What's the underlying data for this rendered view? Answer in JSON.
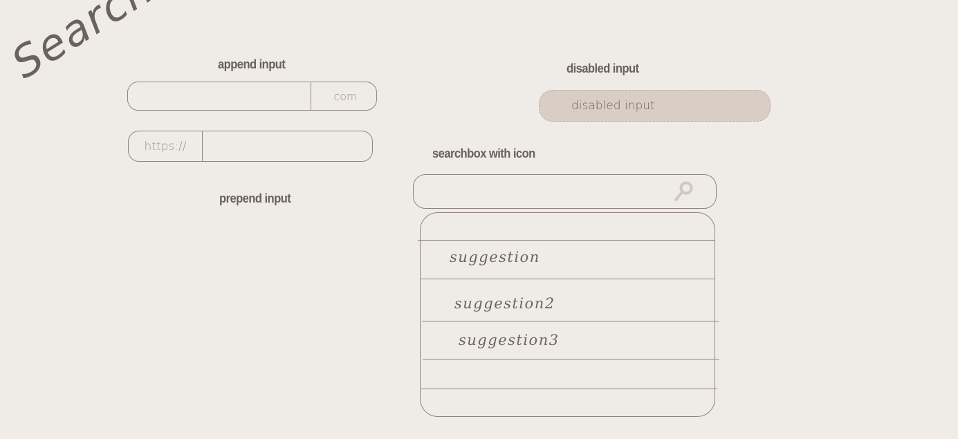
{
  "title": "Searchbox",
  "append": {
    "label": "append input",
    "input_value": "",
    "addon": ".com"
  },
  "prepend": {
    "label": "prepend input",
    "input_value": "",
    "addon": "https://"
  },
  "disabled": {
    "label": "disabled input",
    "value": "disabled input"
  },
  "searchbox": {
    "label": "searchbox with icon",
    "input_value": "",
    "icon": "search-icon",
    "suggestions": [
      "suggestion",
      "suggestion2",
      "suggestion3"
    ]
  },
  "colors": {
    "background": "#efebe7",
    "text": "#6b615a",
    "border": "#8f8580",
    "disabled_fill": "#d8cec6",
    "icon": "#d2c8c0"
  }
}
